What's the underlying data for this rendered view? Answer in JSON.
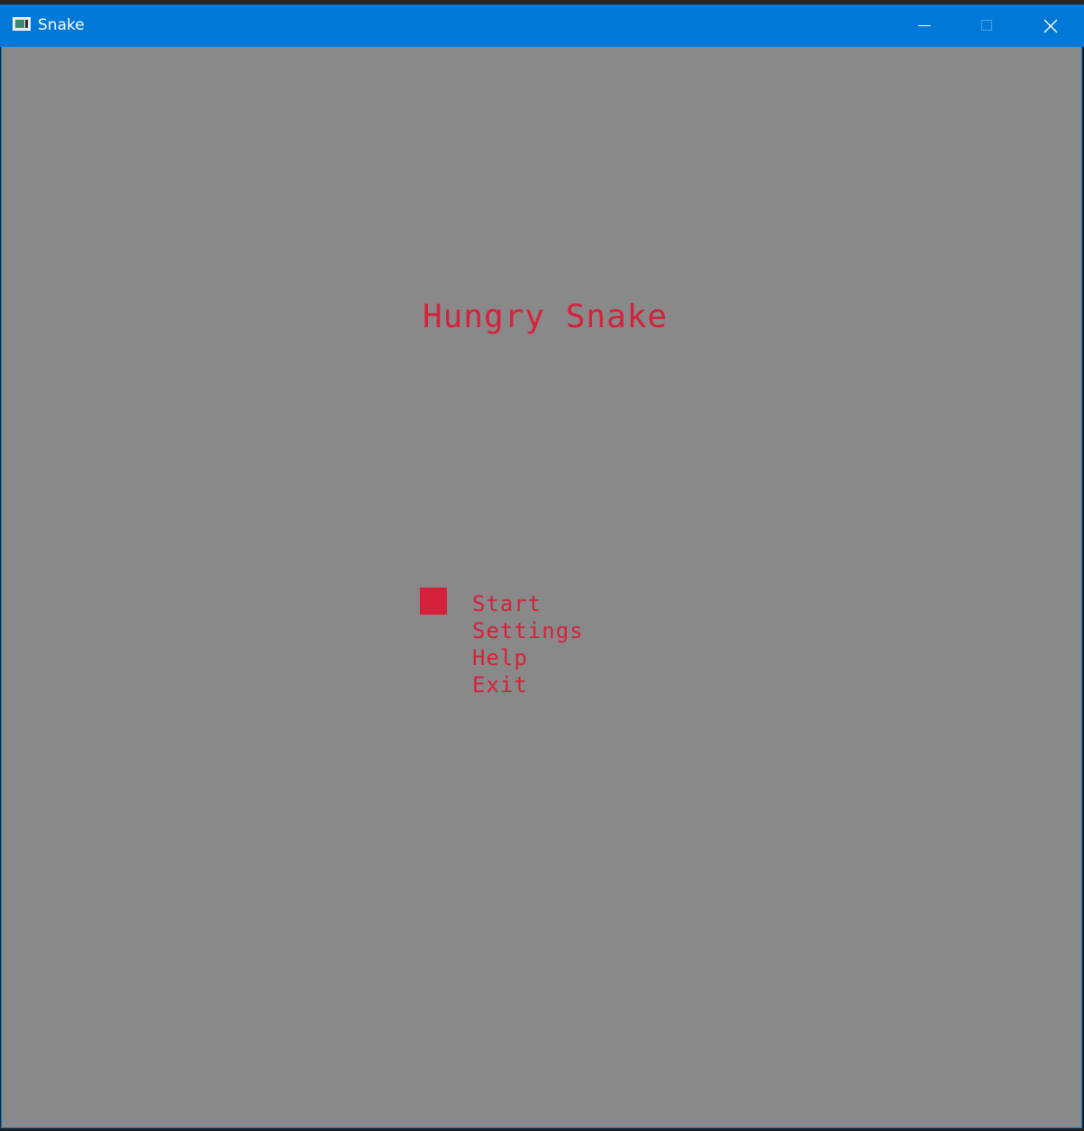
{
  "window": {
    "title": "Snake",
    "colors": {
      "titlebar": "#0078d7",
      "canvas": "#898989",
      "accent": "#d5213b"
    },
    "controls": {
      "minimize_icon": "minimize-icon",
      "maximize_icon": "maximize-icon",
      "close_icon": "close-icon"
    }
  },
  "game": {
    "title": "Hungry Snake",
    "selected_index": 0,
    "menu": [
      {
        "label": "Start"
      },
      {
        "label": "Settings"
      },
      {
        "label": "Help"
      },
      {
        "label": "Exit"
      }
    ]
  }
}
